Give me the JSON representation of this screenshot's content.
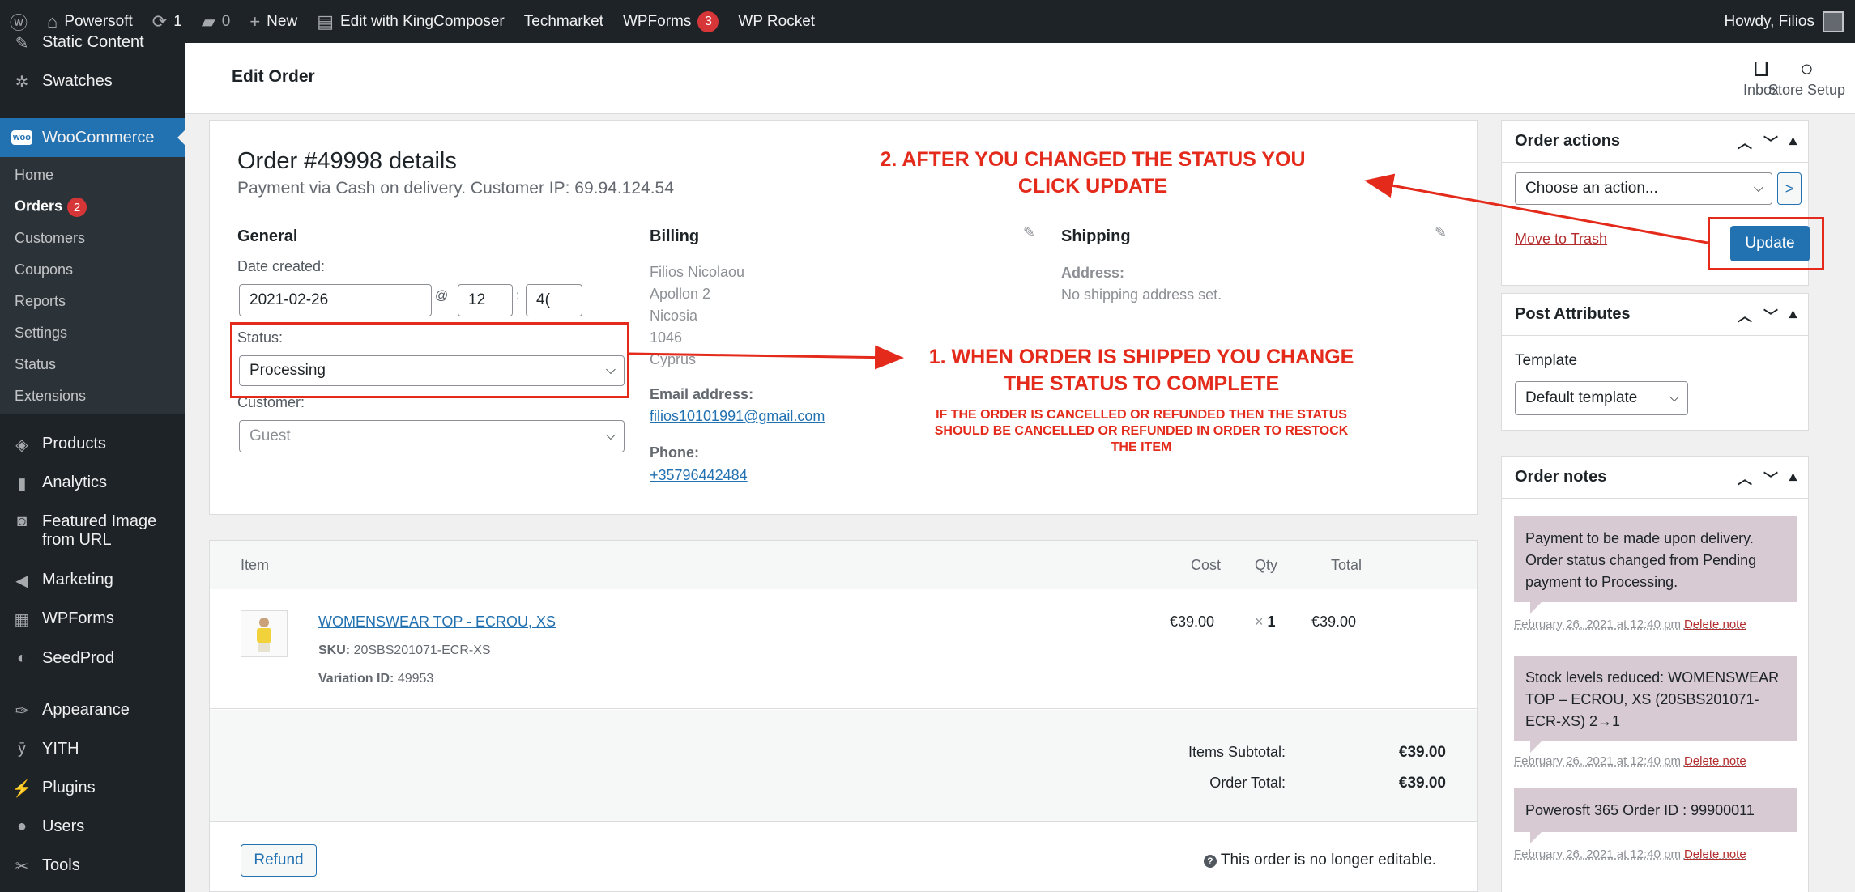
{
  "adminbar": {
    "site_name": "Powersoft",
    "updates": "1",
    "comments": "0",
    "new_label": "New",
    "kingcomposer": "Edit with KingComposer",
    "techmarket": "Techmarket",
    "wpforms": "WPForms",
    "wpforms_count": "3",
    "wprocket": "WP Rocket",
    "howdy": "Howdy, Filios"
  },
  "sidebar": {
    "static_content": "Static Content",
    "swatches": "Swatches",
    "woocommerce": "WooCommerce",
    "woo_logo": "woo",
    "submenu": {
      "home": "Home",
      "orders": "Orders",
      "orders_count": "2",
      "customers": "Customers",
      "coupons": "Coupons",
      "reports": "Reports",
      "settings": "Settings",
      "status": "Status",
      "extensions": "Extensions"
    },
    "products": "Products",
    "analytics": "Analytics",
    "featured_1": "Featured Image",
    "featured_2": "from URL",
    "marketing": "Marketing",
    "wpforms": "WPForms",
    "seedprod": "SeedProd",
    "appearance": "Appearance",
    "yith": "YITH",
    "plugins": "Plugins",
    "users": "Users",
    "tools": "Tools"
  },
  "header": {
    "title": "Edit Order",
    "inbox": "Inbox",
    "store_setup": "Store Setup"
  },
  "order": {
    "heading": "Order #49998 details",
    "payment": "Payment via Cash on delivery. Customer IP: 69.94.124.54",
    "general_title": "General",
    "date_label": "Date created:",
    "date": "2021-02-26",
    "at": "@",
    "hour": "12",
    "colon": ":",
    "minute": "4(",
    "status_label": "Status:",
    "status": "Processing",
    "customer_label": "Customer:",
    "customer": "Guest",
    "billing_title": "Billing",
    "billing_address": "Filios Nicolaou\nApollon 2\nNicosia\n1046\nCyprus",
    "email_label": "Email address:",
    "email": "filios10101991@gmail.com",
    "phone_label": "Phone:",
    "phone": "+35796442484",
    "shipping_title": "Shipping",
    "shipping_addr_label": "Address:",
    "shipping_addr": "No shipping address set."
  },
  "annotations": {
    "step2_line1": "2. AFTER YOU CHANGED THE STATUS YOU",
    "step2_line2": "CLICK UPDATE",
    "step1_line1": "1. WHEN ORDER IS SHIPPED YOU CHANGE",
    "step1_line2": "THE STATUS TO COMPLETE",
    "note_line1": "IF THE ORDER IS CANCELLED OR REFUNDED THEN THE STATUS",
    "note_line2": "SHOULD BE CANCELLED OR REFUNDED IN ORDER TO RESTOCK",
    "note_line3": "THE ITEM"
  },
  "items": {
    "col_item": "Item",
    "col_cost": "Cost",
    "col_qty": "Qty",
    "col_total": "Total",
    "row": {
      "name": "WOMENSWEAR TOP - ECROU, XS",
      "sku_label": "SKU:",
      "sku": "20SBS201071-ECR-XS",
      "variation_label": "Variation ID:",
      "variation": "49953",
      "cost": "€39.00",
      "qty_x": "×",
      "qty": "1",
      "total": "€39.00"
    },
    "subtotal_label": "Items Subtotal:",
    "subtotal": "€39.00",
    "order_total_label": "Order Total:",
    "order_total": "€39.00",
    "refund": "Refund",
    "not_editable": "This order is no longer editable."
  },
  "order_actions": {
    "title": "Order actions",
    "select": "Choose an action...",
    "go": ">",
    "trash": "Move to Trash",
    "update": "Update"
  },
  "post_attributes": {
    "title": "Post Attributes",
    "template_label": "Template",
    "template": "Default template"
  },
  "order_notes": {
    "title": "Order notes",
    "notes": [
      {
        "text": "Payment to be made upon delivery. Order status changed from Pending payment to Processing.",
        "meta": "February 26, 2021 at 12:40 pm",
        "delete": "Delete note"
      },
      {
        "text": "Stock levels reduced: WOMENSWEAR TOP – ECROU, XS (20SBS201071-ECR-XS) 2→1",
        "meta": "February 26, 2021 at 12:40 pm",
        "delete": "Delete note"
      },
      {
        "text": "Powerosft 365 Order ID : 99900011",
        "meta": "February 26, 2021 at 12:40 pm",
        "delete": "Delete note"
      }
    ]
  },
  "colors": {
    "admin_dark": "#1d2327",
    "wp_blue": "#2271b1",
    "annotation_red": "#e32a1b",
    "note_bg": "#d7cad2"
  }
}
